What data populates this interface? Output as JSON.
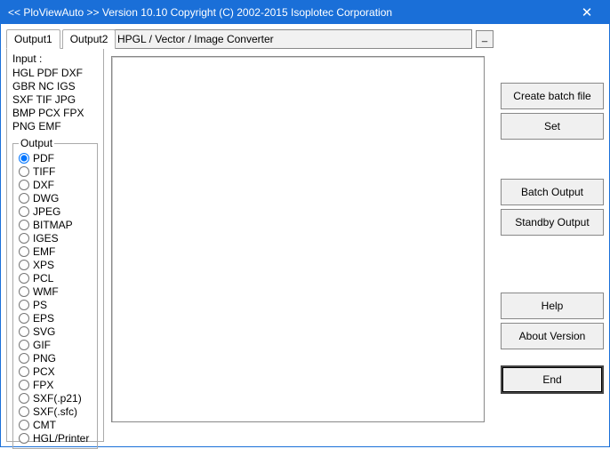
{
  "titlebar": {
    "title": "<<  PloViewAuto >>   Version 10.10 Copyright (C) 2002-2015 Isoplotec Corporation"
  },
  "tabs": {
    "t1": "Output1",
    "t2": "Output2"
  },
  "input": {
    "heading": "Input :",
    "line1": "HGL PDF DXF",
    "line2": "GBR NC  IGS",
    "line3": "SXF TIF JPG",
    "line4": "BMP PCX FPX",
    "line5": "PNG EMF"
  },
  "output": {
    "legend": "Output",
    "formats": [
      "PDF",
      "TIFF",
      "DXF",
      "DWG",
      "JPEG",
      "BITMAP",
      "IGES",
      "EMF",
      "XPS",
      "PCL",
      "WMF",
      "PS",
      "EPS",
      "SVG",
      "GIF",
      "PNG",
      "PCX",
      "FPX",
      "SXF(.p21)",
      "SXF(.sfc)",
      "CMT",
      "HGL/Printer"
    ],
    "selected": "PDF"
  },
  "converter": {
    "label": "HPGL / Vector / Image Converter",
    "mini": "_"
  },
  "buttons": {
    "create_batch": "Create batch file",
    "set": "Set",
    "batch_output": "Batch Output",
    "standby_output": "Standby Output",
    "help": "Help",
    "about": "About Version",
    "end": "End"
  }
}
